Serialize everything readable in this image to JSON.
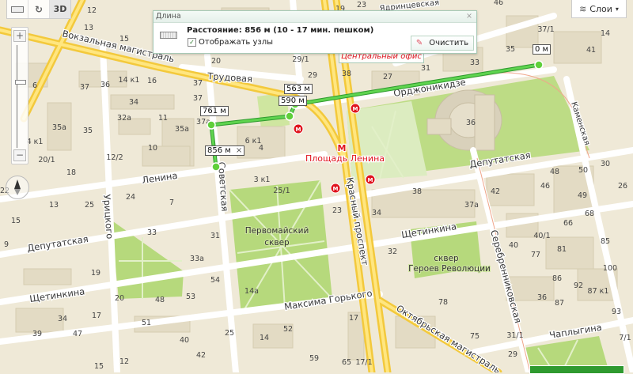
{
  "toolbar": {
    "ruler": "ruler-icon",
    "rotate": "rotate-icon",
    "three_d": "3D"
  },
  "zoom": {
    "plus": "+",
    "minus": "−",
    "level_fraction": 0.35
  },
  "layers": {
    "label": "Слои",
    "arrow": "▾"
  },
  "popup": {
    "title": "Длина",
    "close": "×",
    "distance": "Расстояние: 856 м (10 - 17 мин. пешком)",
    "show_nodes_label": "Отображать узлы",
    "show_nodes_checked": true,
    "clear_label": "Очистить"
  },
  "office_label": "Центральный офис",
  "route": {
    "color": "#3fc43f",
    "labels": [
      "0 м",
      "563 м",
      "590 м",
      "761 м",
      "856 м"
    ],
    "remove": "×"
  },
  "metro": {
    "station": "Площадь Ленина",
    "symbol": "М",
    "color": "#e0141e"
  },
  "streets": [
    "Вокзальная магистраль",
    "Трудовая",
    "Орджоникидзе",
    "Ленина",
    "Депутатская",
    "Депутатская",
    "Щетинкина",
    "Щетинкина",
    "Максима Горького",
    "Красный проспект",
    "Октябрьская магистраль",
    "Серебренниковская",
    "Чаплыгина",
    "Каменская",
    "Урицкого",
    "Советская",
    "Ядринцевская"
  ],
  "parks": [
    "Первомайский",
    "сквер",
    "сквер",
    "Героев Революции"
  ],
  "houses": [
    "12",
    "13",
    "15",
    "14 к1",
    "16",
    "37",
    "36",
    "6",
    "37",
    "35а",
    "35",
    "32а",
    "34",
    "11",
    "37",
    "37а",
    "35а",
    "10",
    "12/2",
    "20/1",
    "4 к1",
    "18",
    "6 к1",
    "4",
    "3 к1",
    "25/1",
    "29/1",
    "29",
    "19",
    "23",
    "27",
    "31",
    "33",
    "38",
    "35",
    "37/1",
    "36",
    "20",
    "24",
    "7",
    "13",
    "25",
    "15",
    "33",
    "31",
    "33а",
    "19",
    "54",
    "20",
    "48",
    "53",
    "17",
    "34",
    "51",
    "39",
    "47",
    "14а",
    "23",
    "38",
    "34",
    "37а",
    "32",
    "78",
    "17",
    "52",
    "59",
    "65",
    "17/1",
    "14",
    "25",
    "48",
    "50",
    "46",
    "42",
    "49",
    "30",
    "26",
    "68",
    "66",
    "40/1",
    "85",
    "40",
    "77",
    "81",
    "100",
    "86",
    "92",
    "87 к1",
    "36",
    "87",
    "93",
    "75",
    "31/1",
    "29",
    "7/1",
    "46",
    "14",
    "41",
    "22",
    "9",
    "40",
    "42",
    "12",
    "15"
  ]
}
